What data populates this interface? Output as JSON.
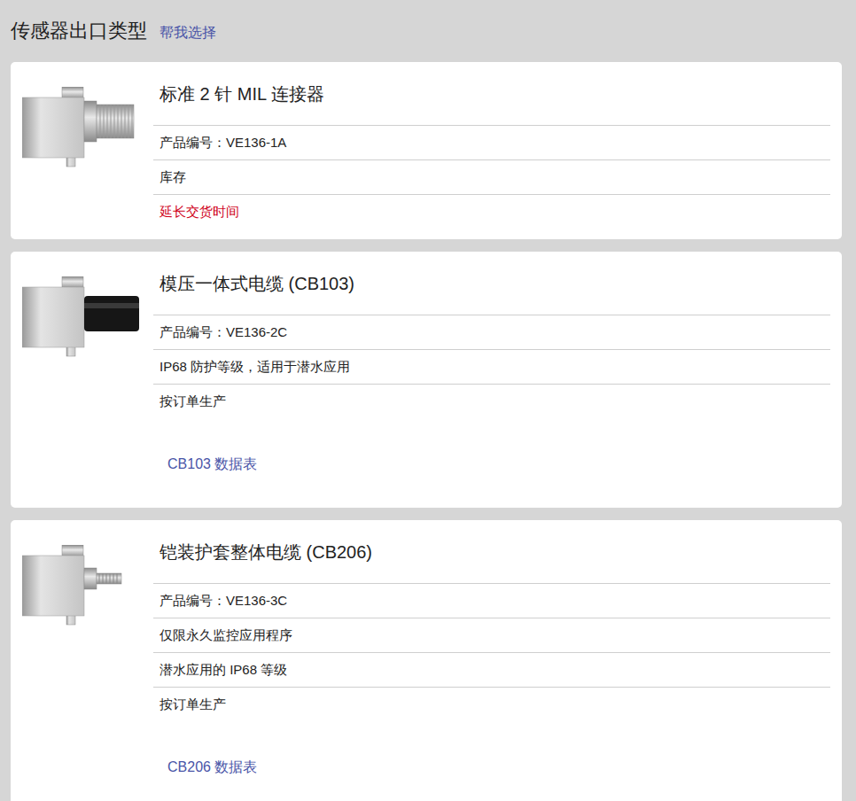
{
  "header": {
    "title": "传感器出口类型",
    "help_link": "帮我选择"
  },
  "cards": [
    {
      "kind": "mil",
      "title": "标准 2 针 MIL 连接器",
      "rows": [
        {
          "text": "产品编号：VE136-1A",
          "warning": false
        },
        {
          "text": "库存",
          "warning": false
        },
        {
          "text": "延长交货时间",
          "warning": true
        }
      ],
      "datasheet": ""
    },
    {
      "kind": "molded",
      "title": "模压一体式电缆 (CB103)",
      "rows": [
        {
          "text": "产品编号：VE136-2C",
          "warning": false
        },
        {
          "text": "IP68 防护等级，适用于潜水应用",
          "warning": false
        },
        {
          "text": "按订单生产",
          "warning": false
        }
      ],
      "datasheet": "CB103 数据表"
    },
    {
      "kind": "armored",
      "title": "铠装护套整体电缆 (CB206)",
      "rows": [
        {
          "text": "产品编号：VE136-3C",
          "warning": false
        },
        {
          "text": "仅限永久监控应用程序",
          "warning": false
        },
        {
          "text": "潜水应用的 IP68 等级",
          "warning": false
        },
        {
          "text": "按订单生产",
          "warning": false
        }
      ],
      "datasheet": "CB206 数据表"
    }
  ]
}
